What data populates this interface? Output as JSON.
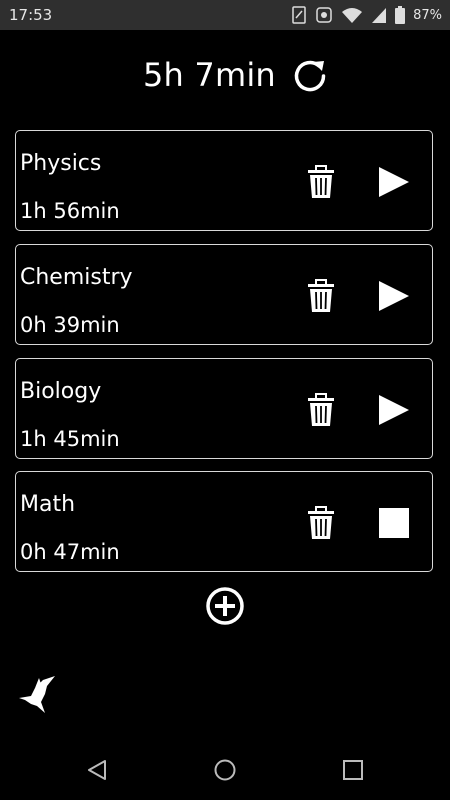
{
  "status_bar": {
    "time": "17:53",
    "battery_percent": "87%",
    "icons": [
      "sim-icon",
      "notification-icon",
      "wifi-icon",
      "signal-icon",
      "battery-icon"
    ]
  },
  "header": {
    "total_time": "5h 7min",
    "reset_icon": "refresh-icon"
  },
  "subjects": [
    {
      "name": "Physics",
      "time": "1h 56min",
      "state": "stopped",
      "action_icon": "play-icon"
    },
    {
      "name": "Chemistry",
      "time": "0h 39min",
      "state": "stopped",
      "action_icon": "play-icon"
    },
    {
      "name": "Biology",
      "time": "1h 45min",
      "state": "stopped",
      "action_icon": "play-icon"
    },
    {
      "name": "Math",
      "time": "0h 47min",
      "state": "running",
      "action_icon": "stop-icon"
    }
  ],
  "add_icon": "add-circle-icon",
  "logo_icon": "bird-logo-icon",
  "nav_bar": {
    "icons": [
      "back-icon",
      "home-icon",
      "recents-icon"
    ]
  },
  "colors": {
    "background": "#000000",
    "status_bar": "#2f2f2f",
    "card_border": "#d9d9d9",
    "foreground": "#ffffff"
  }
}
